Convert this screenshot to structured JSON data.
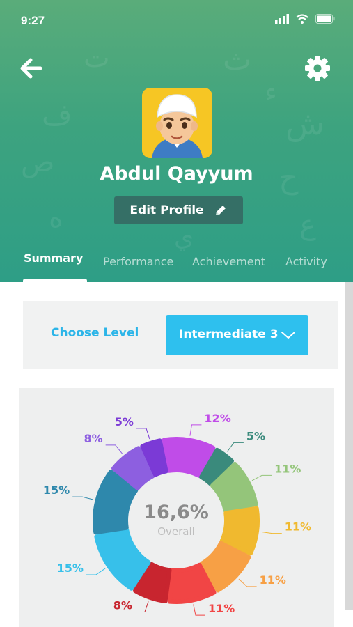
{
  "status_bar": {
    "time": "9:27"
  },
  "profile": {
    "name": "Abdul Qayyum",
    "edit_label": "Edit Profile"
  },
  "tabs": [
    {
      "label": "Summary",
      "active": true
    },
    {
      "label": "Performance",
      "active": false
    },
    {
      "label": "Achievement",
      "active": false
    },
    {
      "label": "Activity",
      "active": false
    }
  ],
  "level": {
    "label": "Choose Level",
    "selected": "Intermediate 3"
  },
  "colors": {
    "header": "#3da37f",
    "accent": "#2cb5e8",
    "dropdown": "#2ec0ee"
  },
  "icons": [
    "back-arrow-icon",
    "gear-icon",
    "signal-icon",
    "wifi-icon",
    "battery-icon",
    "pencil-icon",
    "chevron-down-icon"
  ],
  "chart_data": {
    "type": "pie",
    "center_value": "16,6%",
    "center_label": "Overall",
    "slices": [
      {
        "label": "12%",
        "value": 12,
        "color": "#c04ce8"
      },
      {
        "label": "5%",
        "value": 5,
        "color": "#3a8a7c"
      },
      {
        "label": "11%",
        "value": 11,
        "color": "#94c57a"
      },
      {
        "label": "11%",
        "value": 11,
        "color": "#f0b92f"
      },
      {
        "label": "11%",
        "value": 11,
        "color": "#f7a045"
      },
      {
        "label": "11%",
        "value": 11,
        "color": "#f14545"
      },
      {
        "label": "8%",
        "value": 8,
        "color": "#c8252f"
      },
      {
        "label": "15%",
        "value": 15,
        "color": "#37c0ea"
      },
      {
        "label": "15%",
        "value": 15,
        "color": "#2e88ac"
      },
      {
        "label": "8%",
        "value": 8,
        "color": "#8d5fe0"
      },
      {
        "label": "5%",
        "value": 5,
        "color": "#7b3ad6"
      }
    ]
  }
}
